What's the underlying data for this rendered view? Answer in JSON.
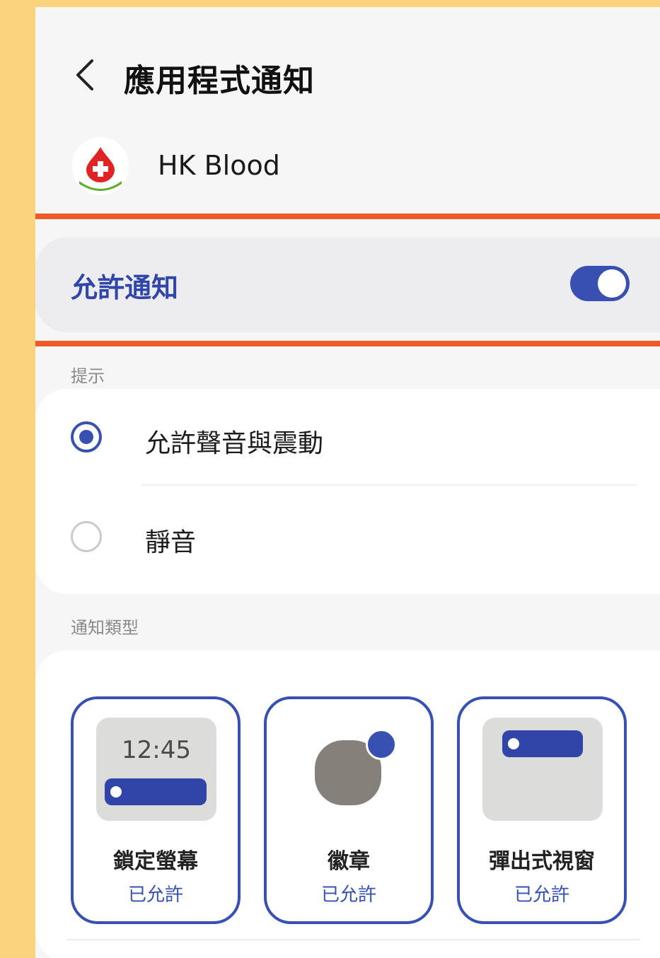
{
  "header": {
    "title": "應用程式通知"
  },
  "app": {
    "name": "HK Blood"
  },
  "allow": {
    "label": "允許通知",
    "enabled": true
  },
  "alerts": {
    "section_label": "提示",
    "options": [
      {
        "label": "允許聲音與震動",
        "selected": true
      },
      {
        "label": "靜音",
        "selected": false
      }
    ]
  },
  "types": {
    "section_label": "通知類型",
    "items": [
      {
        "name": "鎖定螢幕",
        "status": "已允許",
        "preview_time": "12:45"
      },
      {
        "name": "徽章",
        "status": "已允許"
      },
      {
        "name": "彈出式視窗",
        "status": "已允許"
      }
    ]
  },
  "colors": {
    "accent": "#3850B2",
    "highlight": "#EE5A2A",
    "background": "#FBD27E"
  }
}
